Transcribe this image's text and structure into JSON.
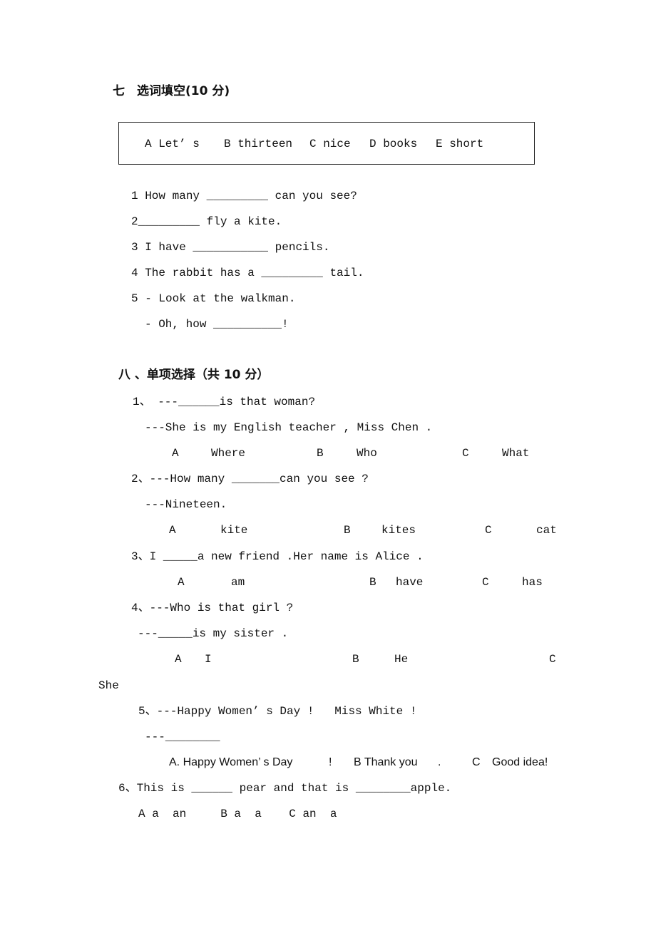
{
  "section7": {
    "title": "七　选词填空(10 分)",
    "word_bank": [
      "A Let’ s",
      "B thirteen",
      "C nice",
      "D books",
      "E short"
    ],
    "items": [
      "1 How many _________ can you see?",
      "2_________ fly a kite.",
      "3 I have ___________ pencils.",
      "4 The rabbit has a _________ tail.",
      "5 - Look at the walkman.",
      "- Oh, how __________!"
    ]
  },
  "section8": {
    "title": "八 、单项选择（共 10 分）",
    "q1": {
      "line1": "1、 ---______is that woman?",
      "line2": "---She is my English teacher , Miss Chen .",
      "options": [
        "A",
        "Where",
        "B",
        "Who",
        "C",
        "What"
      ]
    },
    "q2": {
      "line1": "2、---How many _______can you see ?",
      "line2": "---Nineteen.",
      "options": [
        "A",
        "kite",
        "B",
        "kites",
        "C",
        "cat"
      ]
    },
    "q3": {
      "line1": "3、I _____a new friend .Her name is Alice .",
      "options": [
        "A",
        "am",
        "B",
        "have",
        "C",
        "has"
      ]
    },
    "q4": {
      "line1": "4、---Who is that girl ?",
      "line2": "---_____is my sister .",
      "options": [
        "A",
        "I",
        "B",
        "He",
        "C",
        "She"
      ]
    },
    "q5": {
      "line1": "5、---Happy Women’ s Day !   Miss White !",
      "line2": "---________",
      "options": [
        "A. Happy Women’ s Day",
        "!",
        "B Thank you",
        ".",
        "C",
        "Good idea!"
      ]
    },
    "q6": {
      "line1": "6、This is ______ pear and that is ________apple.",
      "options": "A a  an     B a  a    C an  a"
    }
  }
}
